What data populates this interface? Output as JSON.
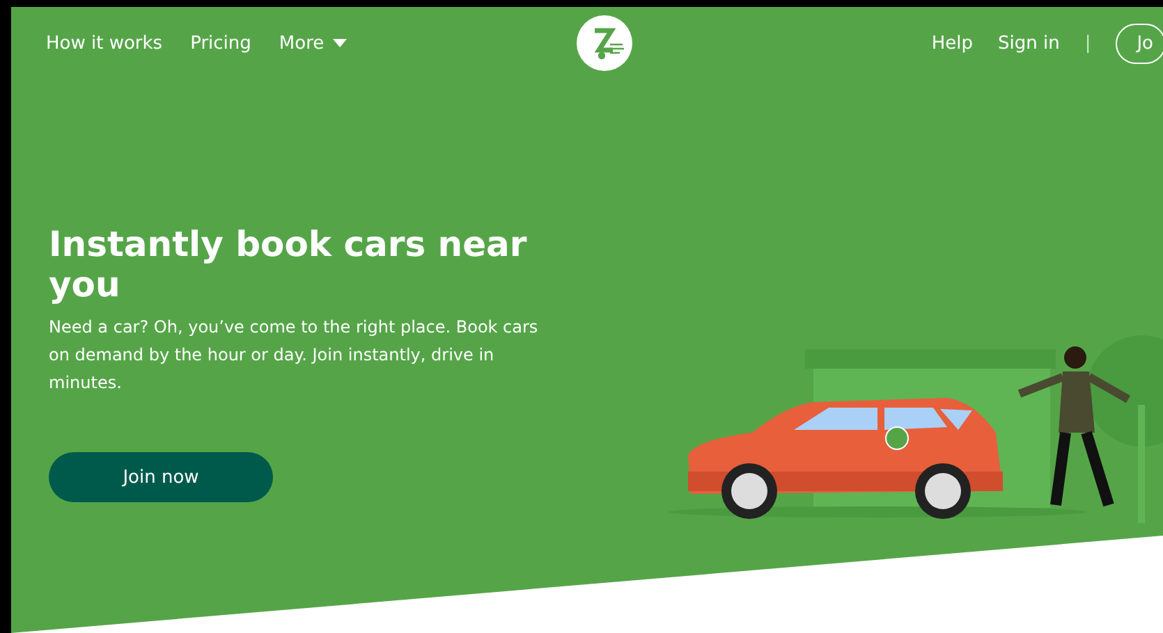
{
  "nav": {
    "left_links": [
      "How it works",
      "Pricing"
    ],
    "more_menu": {
      "label": "More",
      "expanded": false
    },
    "right_links": [
      "Help",
      "Sign in"
    ],
    "separator": "|",
    "join_button": "Jo"
  },
  "hero": {
    "title": "Instantly book cars near you",
    "subtitle": "Need a car? Oh, you’ve come to the right place. Book cars on demand by the hour or day. Join instantly, drive in minutes.",
    "cta": "Join now"
  }
}
